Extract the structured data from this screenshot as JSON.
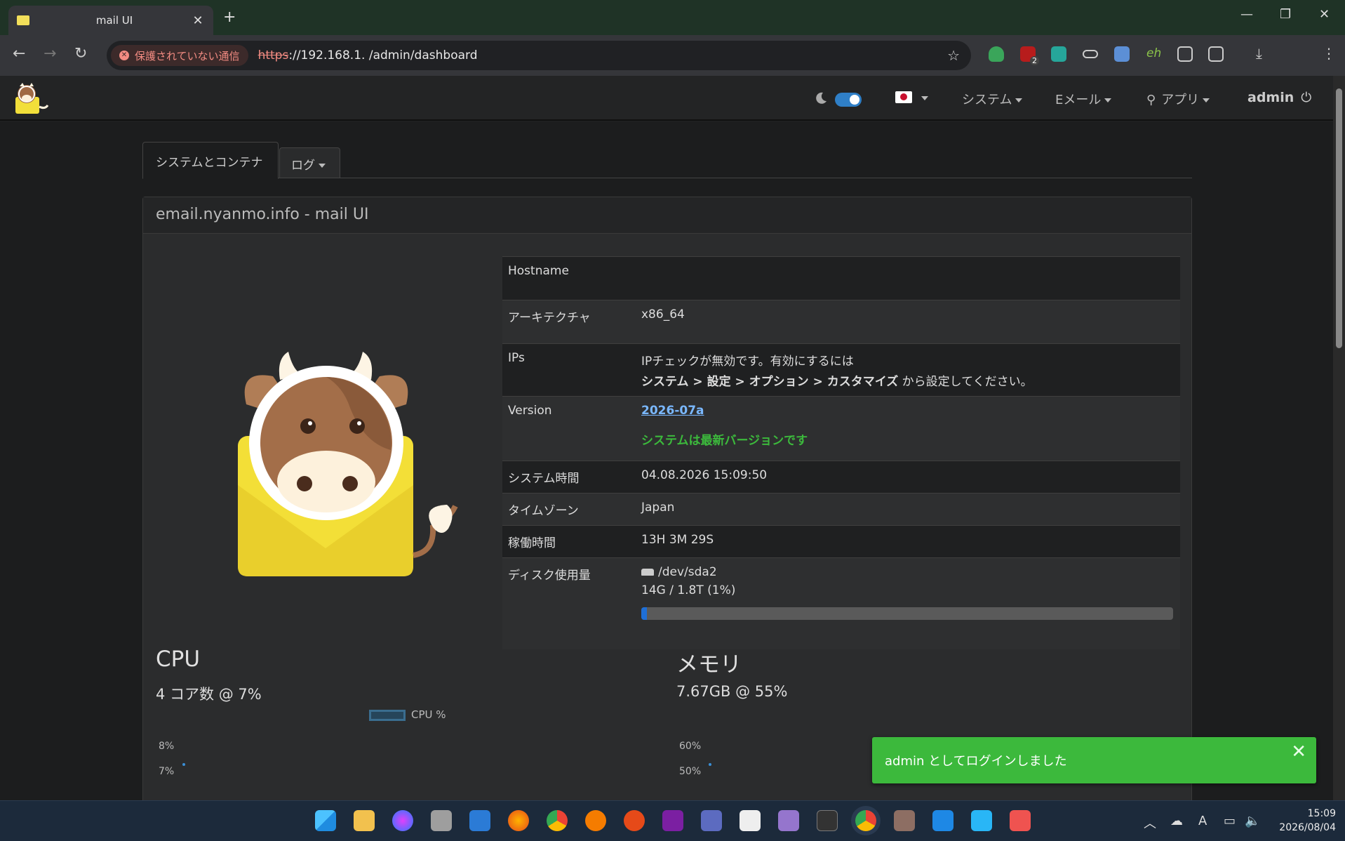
{
  "browser": {
    "tab_title": "mail UI",
    "new_tab": "+",
    "close_tab": "✕",
    "security_chip": "保護されていない通信",
    "url_scheme": "https",
    "url_rest": "://192.168.1.    /admin/dashboard",
    "ext_badge": "2",
    "ext_eh": "eh"
  },
  "nav": {
    "system": "システム",
    "email": "Eメール",
    "apps": "アプリ",
    "user": "admin"
  },
  "tabs": {
    "active": "システムとコンテナ",
    "logs": "ログ"
  },
  "panel": {
    "title": "email.nyanmo.info - mail UI"
  },
  "info": {
    "hostname_label": "Hostname",
    "hostname_value": "",
    "arch_label": "アーキテクチャ",
    "arch_value": "x86_64",
    "ips_label": "IPs",
    "ips_line1": "IPチェックが無効です。有効にするには",
    "ips_path": "システム > 設定 > オプション > カスタマイズ",
    "ips_suffix": " から設定してください。",
    "version_label": "Version",
    "version_value": "2026-07a",
    "version_status": "システムは最新バージョンです",
    "time_label": "システム時間",
    "time_value": "04.08.2026 15:09:50",
    "tz_label": "タイムゾーン",
    "tz_value": "Japan",
    "uptime_label": "稼働時間",
    "uptime_value": "13H 3M 29S",
    "disk_label": "ディスク使用量",
    "disk_device": "/dev/sda2",
    "disk_usage": "14G / 1.8T (1%)",
    "disk_percent": 1
  },
  "cpu": {
    "title": "CPU",
    "subtitle": "4 コア数 @ 7%",
    "legend": "CPU %",
    "ticks": [
      "8%",
      "7%"
    ]
  },
  "memory": {
    "title": "メモリ",
    "subtitle": "7.67GB @ 55%",
    "ticks": [
      "60%",
      "50%"
    ]
  },
  "toast": {
    "message": "admin としてログインしました",
    "close": "✕"
  },
  "clock": {
    "time": "15:09",
    "date": "2026/08/04"
  },
  "colors": {
    "success": "#3cb93c",
    "link": "#7ab8ff",
    "progress": "#1f6fd6"
  }
}
